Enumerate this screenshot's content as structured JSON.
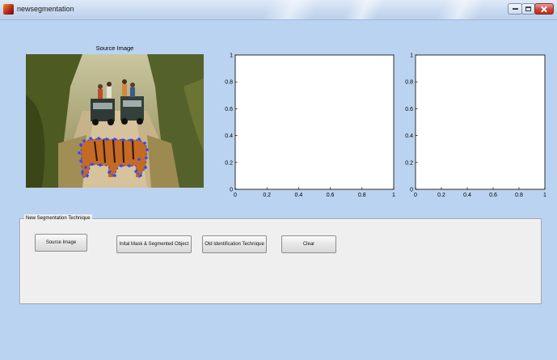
{
  "window": {
    "title": "newsegmentation"
  },
  "source_image": {
    "title": "Source Image"
  },
  "axes": [
    {
      "x_ticks": [
        "0",
        "0.2",
        "0.4",
        "0.6",
        "0.8",
        "1"
      ],
      "y_ticks": [
        "0",
        "0.2",
        "0.4",
        "0.6",
        "0.8",
        "1"
      ]
    },
    {
      "x_ticks": [
        "0",
        "0.2",
        "0.4",
        "0.6",
        "0.8",
        "1"
      ],
      "y_ticks": [
        "0",
        "0.2",
        "0.4",
        "0.6",
        "0.8",
        "1"
      ]
    }
  ],
  "panel": {
    "title": "New Segmentation Technique",
    "buttons": {
      "source": "Source Image",
      "initial_mask": "Inital Mask & Segmented Object",
      "old_identification": "Old Identification Technique",
      "clear": "Clear"
    }
  },
  "colors": {
    "background": "#b9d3f1",
    "panel": "#efefef",
    "mask_points": "#3344ff"
  }
}
